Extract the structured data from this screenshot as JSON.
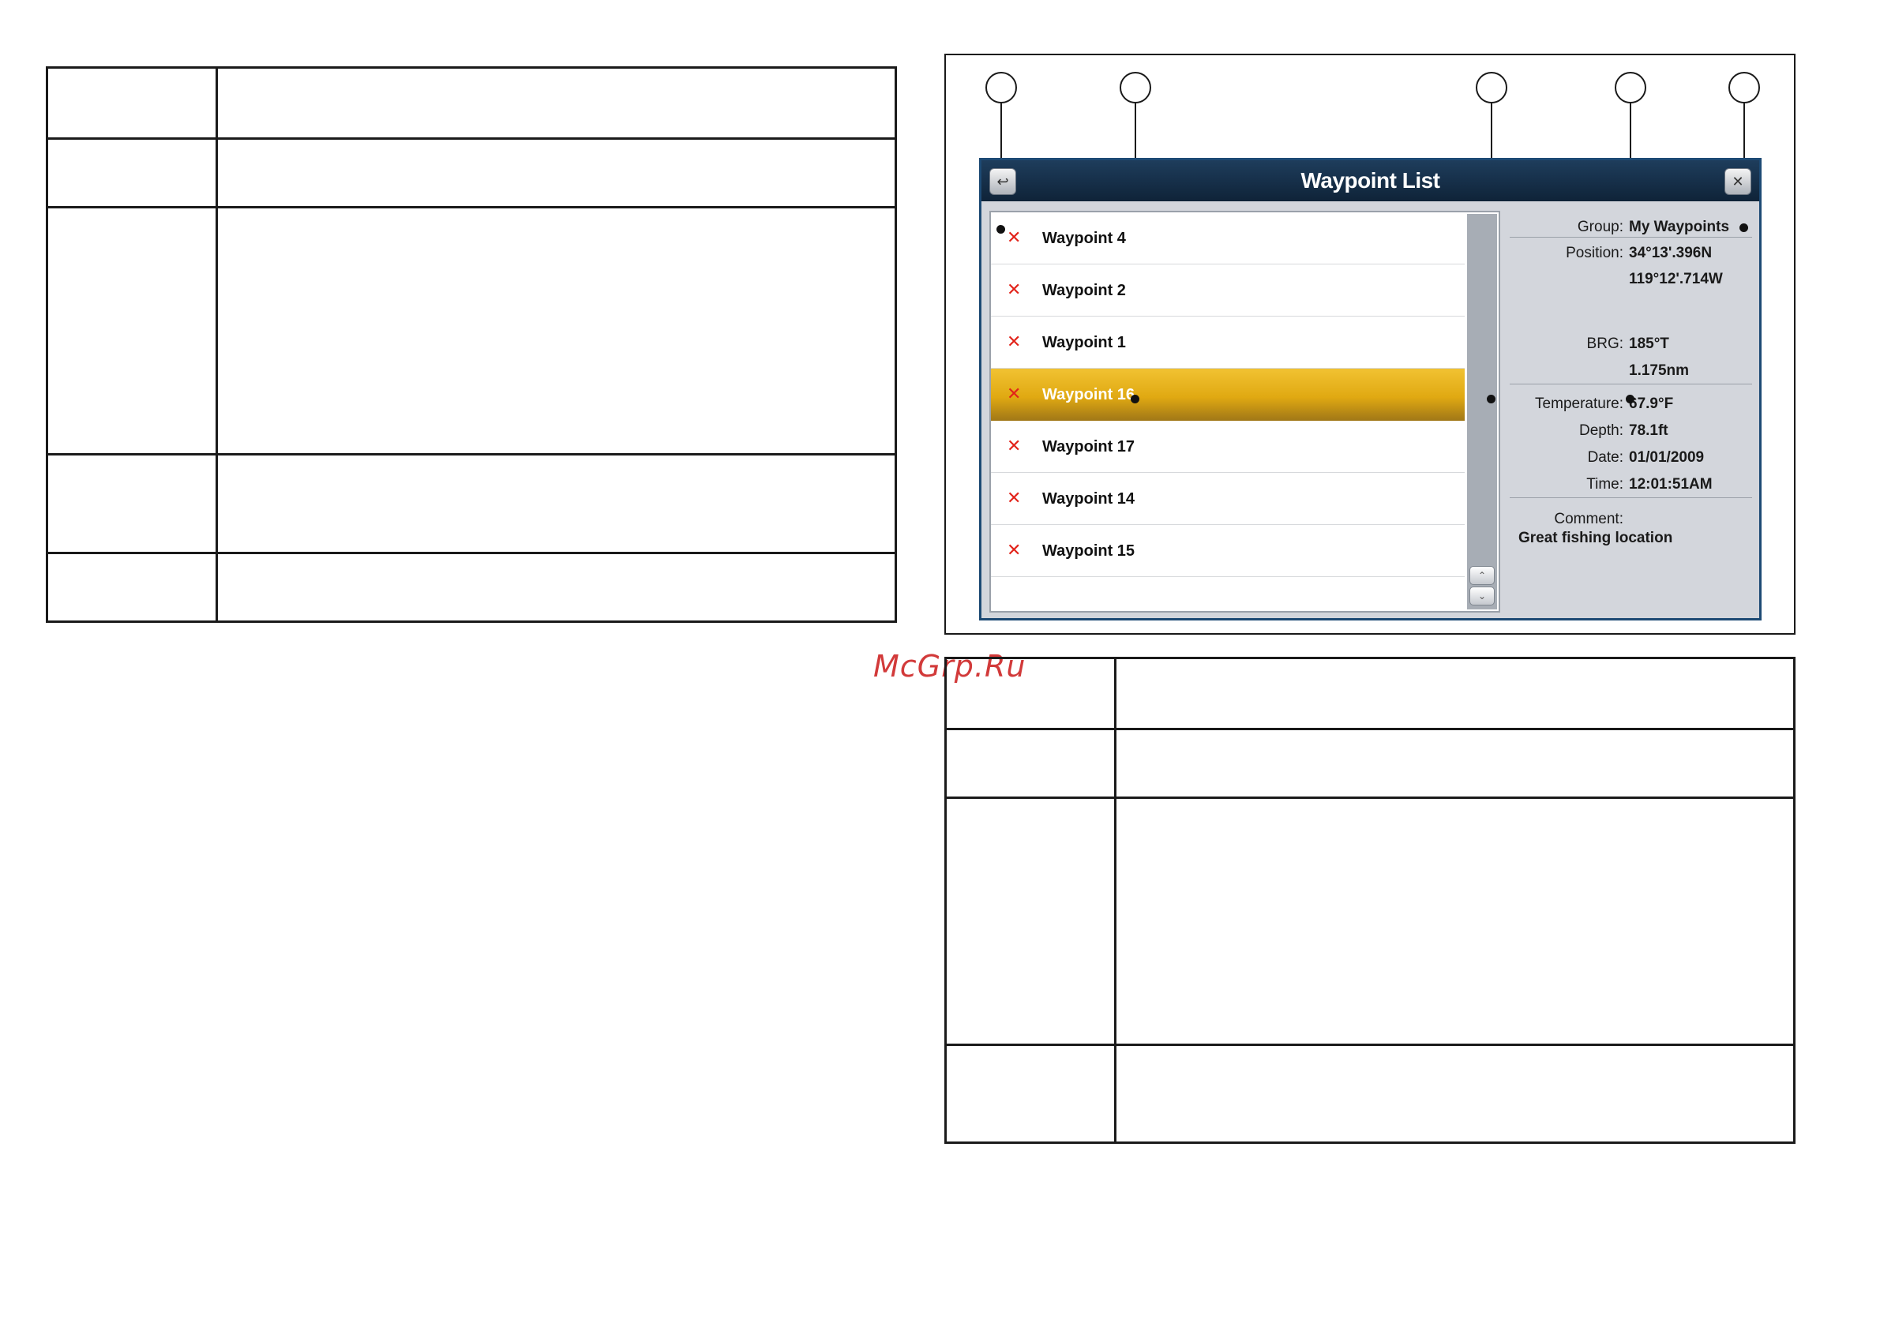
{
  "watermark": "McGrp.Ru",
  "screen": {
    "title": "Waypoint List",
    "back_icon": "back-arrow-icon",
    "close_icon": "close-icon",
    "waypoints": [
      {
        "label": "Waypoint  4",
        "selected": false
      },
      {
        "label": "Waypoint  2",
        "selected": false
      },
      {
        "label": "Waypoint  1",
        "selected": false
      },
      {
        "label": "Waypoint  16",
        "selected": true
      },
      {
        "label": "Waypoint  17",
        "selected": false
      },
      {
        "label": "Waypoint  14",
        "selected": false
      },
      {
        "label": "Waypoint  15",
        "selected": false
      }
    ],
    "delete_glyph": "✕",
    "details": {
      "group_label": "Group:",
      "group_value": "My Waypoints",
      "position_label": "Position:",
      "position_lat": "34°13'.396N",
      "position_lon": "119°12'.714W",
      "brg_label": "BRG:",
      "brg_value": "185°T",
      "distance_value": "1.175nm",
      "temperature_label": "Temperature:",
      "temperature_value": "67.9°F",
      "depth_label": "Depth:",
      "depth_value": "78.1ft",
      "date_label": "Date:",
      "date_value": "01/01/2009",
      "time_label": "Time:",
      "time_value": "12:01:51AM",
      "comment_label": "Comment:",
      "comment_value": "Great fishing location"
    }
  },
  "colors": {
    "titlebar": "#0f2338",
    "selected_row": "#e0a912",
    "delete_x": "#e2231a",
    "panel": "#d3d6dc",
    "watermark": "#d23a3a"
  }
}
